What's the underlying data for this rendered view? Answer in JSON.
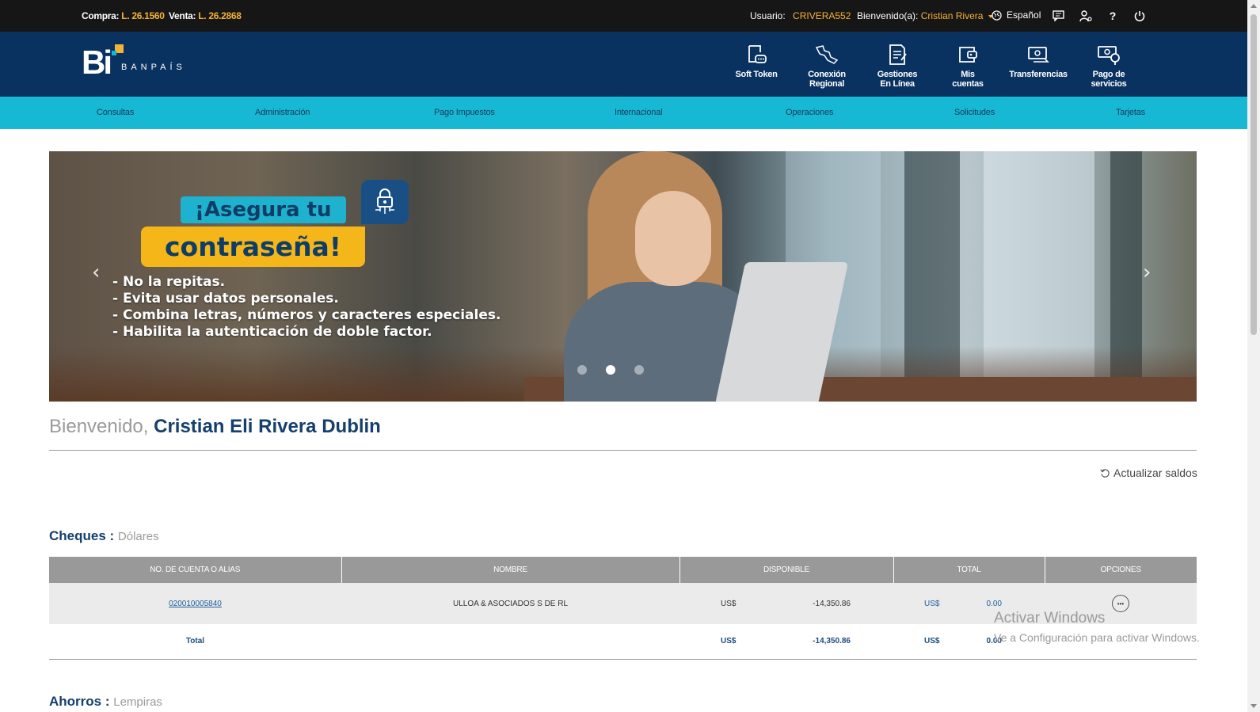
{
  "topbar": {
    "buy_label": "Compra:",
    "buy_value": "L. 26.1560",
    "sell_label": "Venta:",
    "sell_value": "L. 26.2868",
    "user_label": "Usuario:",
    "user_value": "CRIVERA552",
    "welcome_label": "Bienvenido(a):",
    "welcome_value": "Cristian Rivera",
    "language": "Español"
  },
  "header": {
    "logo_mark": "Bi",
    "logo_text": "BANPAÍS",
    "nav": [
      {
        "label": "Soft Token",
        "icon": "soft-token-icon"
      },
      {
        "label": "Conexión\nRegional",
        "icon": "conexion-regional-icon"
      },
      {
        "label": "Gestiones\nEn Línea",
        "icon": "gestiones-icon"
      },
      {
        "label": "Mis\ncuentas",
        "icon": "mis-cuentas-icon"
      },
      {
        "label": "Transferencias",
        "icon": "transferencias-icon"
      },
      {
        "label": "Pago de\nservicios",
        "icon": "pago-servicios-icon"
      }
    ]
  },
  "menu": [
    "Consultas",
    "Administración",
    "Pago Impuestos",
    "Internacional",
    "Operaciones",
    "Solicitudes",
    "Tarjetas"
  ],
  "banner": {
    "headline_top": "¡Asegura tu",
    "headline_main": "contraseña!",
    "tips": [
      "- No la repitas.",
      "- Evita usar datos personales.",
      "- Combina letras, números y caracteres especiales.",
      "- Habilita la autenticación de doble factor."
    ],
    "active_slide": 2,
    "slide_count": 3
  },
  "welcome": {
    "prefix": "Bienvenido,",
    "name": "Cristian Eli Rivera Dublin"
  },
  "refresh_label": "Actualizar saldos",
  "cheques": {
    "title": "Cheques :",
    "currency": "Dólares",
    "columns": [
      "NO. DE CUENTA O ALIAS",
      "NOMBRE",
      "DISPONIBLE",
      "TOTAL",
      "OPCIONES"
    ],
    "rows": [
      {
        "account": "020010005840",
        "name": "ULLOA & ASOCIADOS S DE RL",
        "avail_cur": "US$",
        "avail": "-14,350.86",
        "total_cur": "US$",
        "total": "0.00"
      }
    ],
    "total_row": {
      "label": "Total",
      "avail_cur": "US$",
      "avail": "-14,350.86",
      "total_cur": "US$",
      "total": "0.00"
    }
  },
  "ahorros": {
    "title": "Ahorros :",
    "currency": "Lempiras"
  },
  "watermark": {
    "title": "Activar Windows",
    "subtitle": "Ve a Configuración para activar Windows."
  },
  "colors": {
    "topbar_bg": "#161616",
    "header_bg": "#0a3261",
    "menu_bg": "#17b8d3",
    "accent": "#f5b335",
    "title_blue": "#143f6e"
  }
}
